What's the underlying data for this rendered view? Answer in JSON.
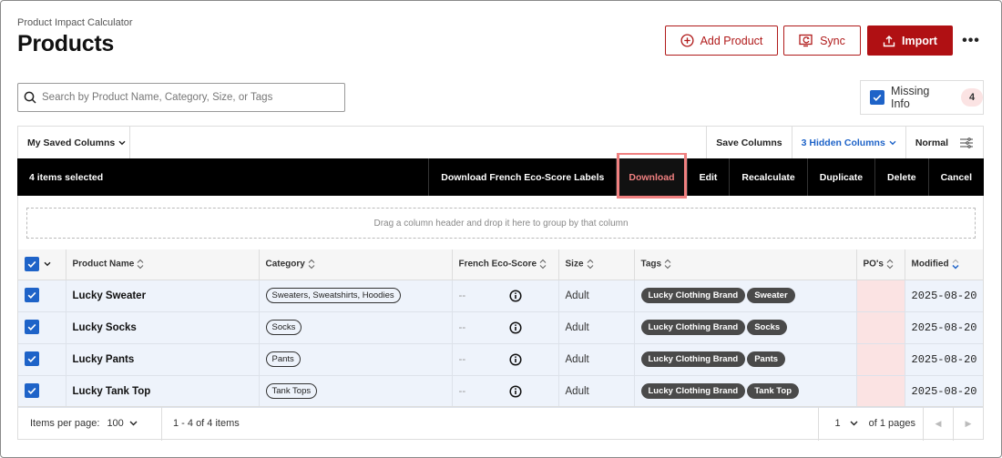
{
  "app": {
    "title": "Product Impact Calculator",
    "page_title": "Products"
  },
  "header_buttons": {
    "add_product": "Add Product",
    "sync": "Sync",
    "import": "Import"
  },
  "search": {
    "placeholder": "Search by Product Name, Category, Size, or Tags",
    "value": ""
  },
  "missing_info": {
    "label": "Missing Info",
    "count": "4",
    "checked": true
  },
  "toolbar": {
    "saved_columns": "My Saved Columns",
    "save_columns": "Save Columns",
    "hidden_columns": "3 Hidden Columns",
    "density": "Normal"
  },
  "selection_bar": {
    "selected_text": "4 items selected",
    "actions": [
      "Download French Eco-Score Labels",
      "Download",
      "Edit",
      "Recalculate",
      "Duplicate",
      "Delete",
      "Cancel"
    ]
  },
  "group_zone": "Drag a column header and drop it here to group by that column",
  "table": {
    "columns": {
      "name": "Product Name",
      "category": "Category",
      "eco": "French Eco-Score",
      "size": "Size",
      "tags": "Tags",
      "pos": "PO's",
      "modified": "Modified"
    },
    "rows": [
      {
        "name": "Lucky Sweater",
        "category": "Sweaters, Sweatshirts, Hoodies",
        "eco": "--",
        "size": "Adult",
        "tags": [
          "Lucky Clothing Brand",
          "Sweater"
        ],
        "modified": "2025-08-20"
      },
      {
        "name": "Lucky Socks",
        "category": "Socks",
        "eco": "--",
        "size": "Adult",
        "tags": [
          "Lucky Clothing Brand",
          "Socks"
        ],
        "modified": "2025-08-20"
      },
      {
        "name": "Lucky Pants",
        "category": "Pants",
        "eco": "--",
        "size": "Adult",
        "tags": [
          "Lucky Clothing Brand",
          "Pants"
        ],
        "modified": "2025-08-20"
      },
      {
        "name": "Lucky Tank Top",
        "category": "Tank Tops",
        "eco": "--",
        "size": "Adult",
        "tags": [
          "Lucky Clothing Brand",
          "Tank Top"
        ],
        "modified": "2025-08-20"
      }
    ]
  },
  "footer": {
    "items_per_page_label": "Items per page:",
    "items_per_page_value": "100",
    "range": "1 - 4 of 4 items",
    "page": "1",
    "of_pages": "of 1 pages"
  },
  "colors": {
    "brand_red": "#b01013",
    "accent_blue": "#1e63c8",
    "highlight": "#f08080"
  }
}
